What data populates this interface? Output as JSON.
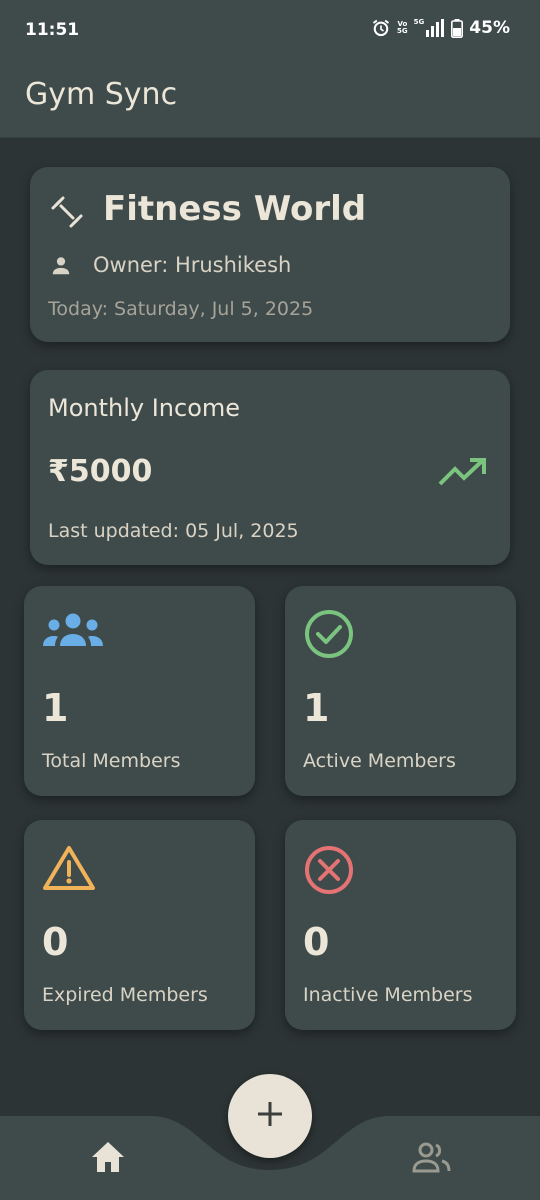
{
  "status_bar": {
    "time": "11:51",
    "volte_label": "Vo",
    "volte_sub": "5G",
    "network_label": "5G",
    "battery": "45%"
  },
  "app_bar": {
    "title": "Gym Sync"
  },
  "gym": {
    "name": "Fitness World",
    "owner": "Owner: Hrushikesh",
    "today": "Today: Saturday, Jul 5, 2025",
    "icon": "dumbbell-icon"
  },
  "income": {
    "title": "Monthly Income",
    "value": "₹5000",
    "last_updated": "Last updated: 05 Jul, 2025",
    "icon": "trending-up-icon"
  },
  "stats": [
    {
      "value": "1",
      "label": "Total Members",
      "icon": "group-icon",
      "color": "#6aaee8"
    },
    {
      "value": "1",
      "label": "Active Members",
      "icon": "check-circle-icon",
      "color": "#7bc47f"
    },
    {
      "value": "0",
      "label": "Expired Members",
      "icon": "warning-icon",
      "color": "#f0b35a"
    },
    {
      "value": "0",
      "label": "Inactive Members",
      "icon": "cancel-circle-icon",
      "color": "#e57373"
    }
  ],
  "bottom_nav": {
    "items": [
      {
        "icon": "home-icon",
        "selected": true
      },
      {
        "icon": "members-icon",
        "selected": false
      }
    ],
    "fab_icon": "plus-icon"
  },
  "colors": {
    "background": "#2c3435",
    "surface": "#3f4b4b",
    "text": "#ece6d8",
    "trend": "#7bc47f"
  }
}
